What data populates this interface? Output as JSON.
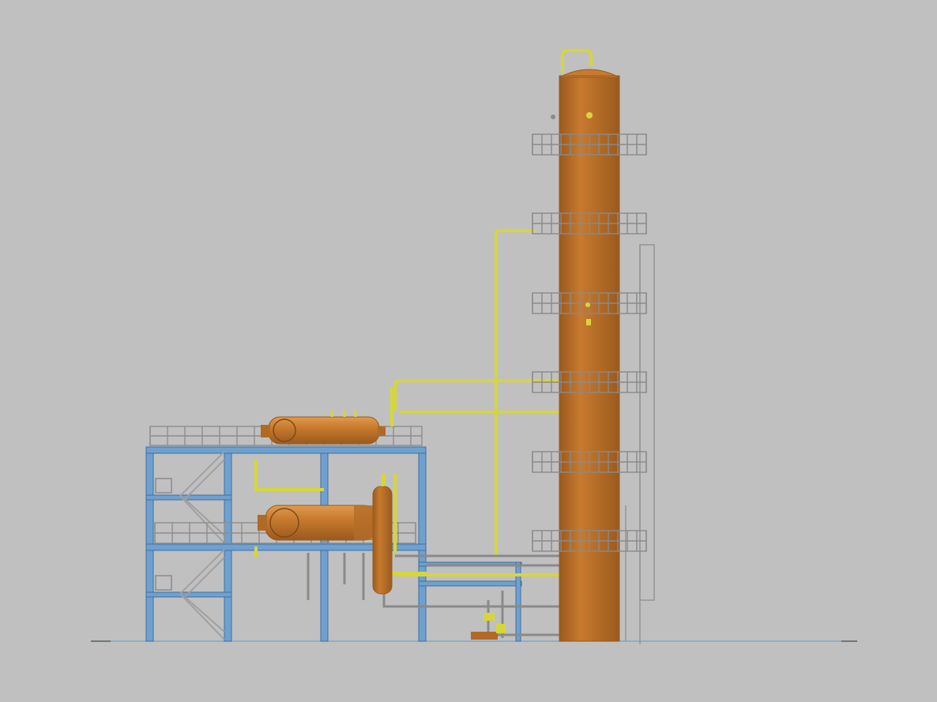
{
  "viewport": {
    "background_color": "#c0c0c0"
  },
  "palette": {
    "vessel": "#c87a2e",
    "vessel_shadow": "#9a5a1e",
    "vessel_highlight": "#e09a4e",
    "steel_structure": "#6fa0cf",
    "steel_structure_edge": "#3f6f9f",
    "pipe_yellow": "#d6d63a",
    "pipe_yellow_edge": "#8c8c1e",
    "grating_gray": "#888888",
    "ground_line": "#7aa0c8"
  },
  "equipment": [
    {
      "name": "distillation-column",
      "kind": "vertical-vessel"
    },
    {
      "name": "upper-horizontal-drum",
      "kind": "horizontal-vessel"
    },
    {
      "name": "lower-horizontal-exchanger",
      "kind": "horizontal-vessel"
    },
    {
      "name": "small-vertical-drum",
      "kind": "vertical-vessel"
    }
  ],
  "column_platforms": 6,
  "structure_levels": 3
}
